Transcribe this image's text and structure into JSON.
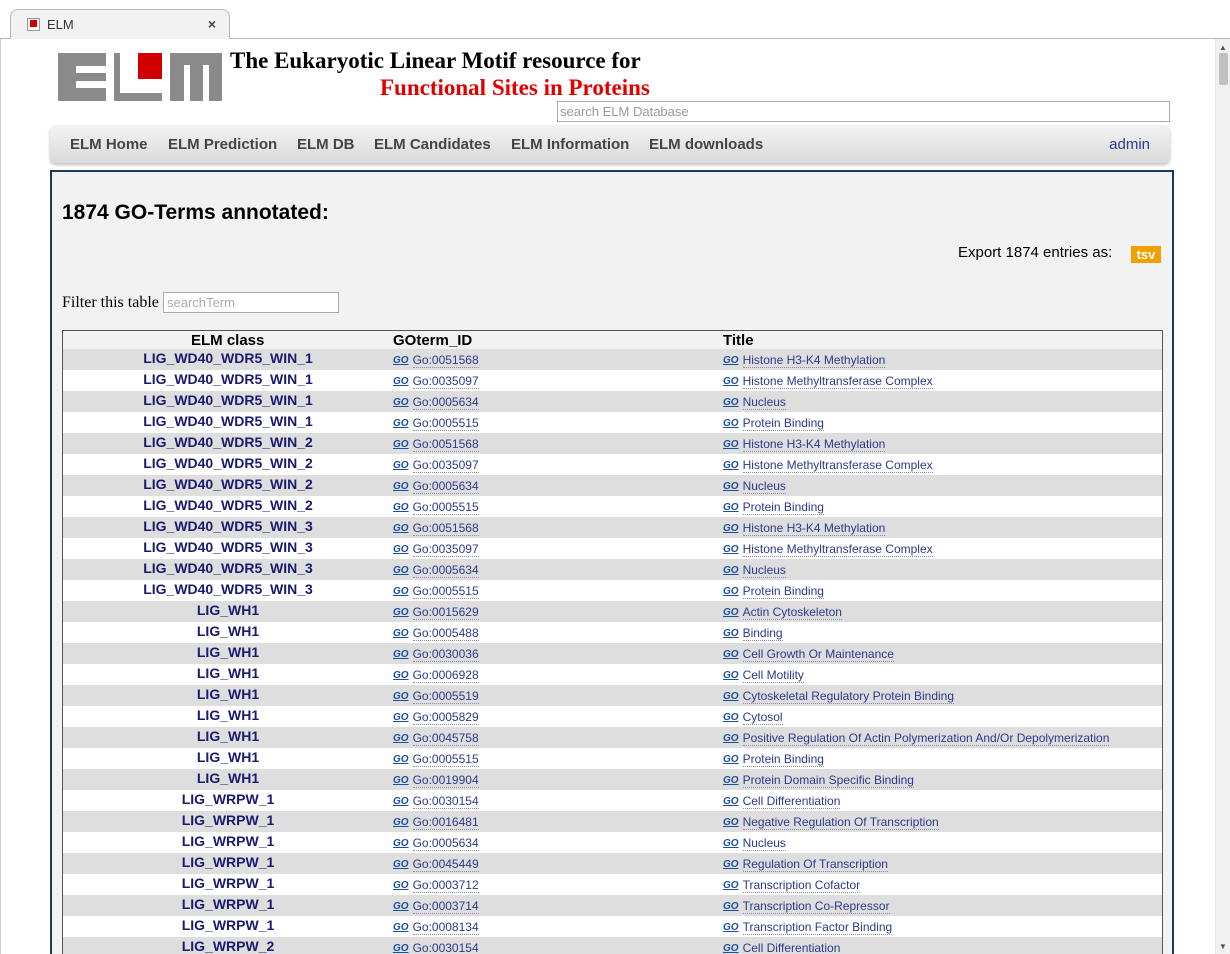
{
  "browser": {
    "tab_title": "ELM",
    "tab_close": "×"
  },
  "header": {
    "logo_text": "ELM",
    "title_line1": "The Eukaryotic Linear Motif resource for",
    "title_line2": "Functional Sites in Proteins",
    "search_placeholder": "search ELM Database"
  },
  "nav": {
    "items": [
      "ELM Home",
      "ELM Prediction",
      "ELM DB",
      "ELM Candidates",
      "ELM Information",
      "ELM downloads"
    ],
    "admin": "admin"
  },
  "main": {
    "title": "1874 GO-Terms annotated:",
    "export_label": "Export 1874 entries as:",
    "export_button": "tsv",
    "filter_label": "Filter this table",
    "filter_placeholder": "searchTerm"
  },
  "table": {
    "go_icon": "GO",
    "columns": [
      "ELM class",
      "GOterm_ID",
      "Title"
    ],
    "rows": [
      [
        "LIG_WD40_WDR5_WIN_1",
        "Go:0051568",
        "Histone H3-K4 Methylation"
      ],
      [
        "LIG_WD40_WDR5_WIN_1",
        "Go:0035097",
        "Histone Methyltransferase Complex"
      ],
      [
        "LIG_WD40_WDR5_WIN_1",
        "Go:0005634",
        "Nucleus"
      ],
      [
        "LIG_WD40_WDR5_WIN_1",
        "Go:0005515",
        "Protein Binding"
      ],
      [
        "LIG_WD40_WDR5_WIN_2",
        "Go:0051568",
        "Histone H3-K4 Methylation"
      ],
      [
        "LIG_WD40_WDR5_WIN_2",
        "Go:0035097",
        "Histone Methyltransferase Complex"
      ],
      [
        "LIG_WD40_WDR5_WIN_2",
        "Go:0005634",
        "Nucleus"
      ],
      [
        "LIG_WD40_WDR5_WIN_2",
        "Go:0005515",
        "Protein Binding"
      ],
      [
        "LIG_WD40_WDR5_WIN_3",
        "Go:0051568",
        "Histone H3-K4 Methylation"
      ],
      [
        "LIG_WD40_WDR5_WIN_3",
        "Go:0035097",
        "Histone Methyltransferase Complex"
      ],
      [
        "LIG_WD40_WDR5_WIN_3",
        "Go:0005634",
        "Nucleus"
      ],
      [
        "LIG_WD40_WDR5_WIN_3",
        "Go:0005515",
        "Protein Binding"
      ],
      [
        "LIG_WH1",
        "Go:0015629",
        "Actin Cytoskeleton"
      ],
      [
        "LIG_WH1",
        "Go:0005488",
        "Binding"
      ],
      [
        "LIG_WH1",
        "Go:0030036",
        "Cell Growth Or Maintenance"
      ],
      [
        "LIG_WH1",
        "Go:0006928",
        "Cell Motility"
      ],
      [
        "LIG_WH1",
        "Go:0005519",
        "Cytoskeletal Regulatory Protein Binding"
      ],
      [
        "LIG_WH1",
        "Go:0005829",
        "Cytosol"
      ],
      [
        "LIG_WH1",
        "Go:0045758",
        "Positive Regulation Of Actin Polymerization And/Or Depolymerization"
      ],
      [
        "LIG_WH1",
        "Go:0005515",
        "Protein Binding"
      ],
      [
        "LIG_WH1",
        "Go:0019904",
        "Protein Domain Specific Binding"
      ],
      [
        "LIG_WRPW_1",
        "Go:0030154",
        "Cell Differentiation"
      ],
      [
        "LIG_WRPW_1",
        "Go:0016481",
        "Negative Regulation Of Transcription"
      ],
      [
        "LIG_WRPW_1",
        "Go:0005634",
        "Nucleus"
      ],
      [
        "LIG_WRPW_1",
        "Go:0045449",
        "Regulation Of Transcription"
      ],
      [
        "LIG_WRPW_1",
        "Go:0003712",
        "Transcription Cofactor"
      ],
      [
        "LIG_WRPW_1",
        "Go:0003714",
        "Transcription Co-Repressor"
      ],
      [
        "LIG_WRPW_1",
        "Go:0008134",
        "Transcription Factor Binding"
      ],
      [
        "LIG_WRPW_2",
        "Go:0030154",
        "Cell Differentiation"
      ]
    ]
  },
  "colors": {
    "accent_red": "#e00000",
    "link": "#2b3a8a",
    "class_text": "#1a1a70",
    "tsv": "#f0a000",
    "panel_border": "#1b3a5a"
  }
}
